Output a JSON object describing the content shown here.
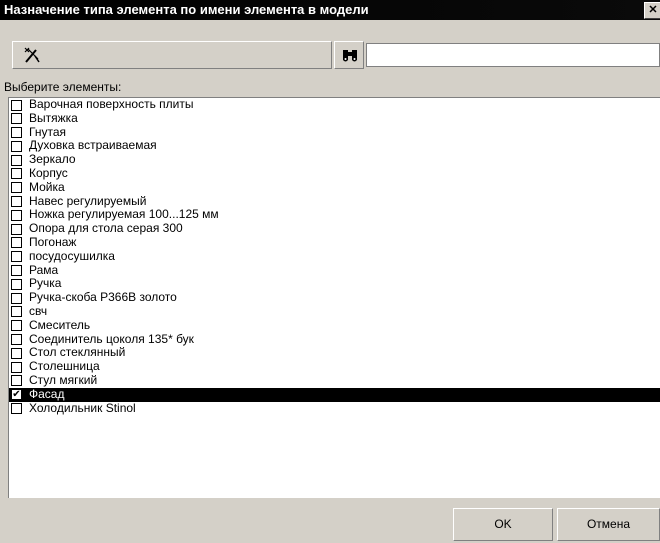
{
  "window": {
    "title": "Назначение типа элемента по имени элемента в модели",
    "close_glyph": "✕"
  },
  "toolbar": {
    "filter_icon": "magic-wand-icon",
    "search_icon": "binoculars-icon",
    "search_value": ""
  },
  "list": {
    "label": "Выберите элементы:",
    "items": [
      {
        "label": "Варочная поверхность плиты",
        "checked": false
      },
      {
        "label": "Вытяжка",
        "checked": false
      },
      {
        "label": "Гнутая",
        "checked": false
      },
      {
        "label": "Духовка встраиваемая",
        "checked": false
      },
      {
        "label": "Зеркало",
        "checked": false
      },
      {
        "label": "Корпус",
        "checked": false
      },
      {
        "label": "Мойка",
        "checked": false
      },
      {
        "label": "Навес регулируемый",
        "checked": false
      },
      {
        "label": "Ножка регулируемая 100...125 мм",
        "checked": false
      },
      {
        "label": "Опора для стола серая 300",
        "checked": false
      },
      {
        "label": "Погонаж",
        "checked": false
      },
      {
        "label": "посудосушилка",
        "checked": false
      },
      {
        "label": "Рама",
        "checked": false
      },
      {
        "label": "Ручка",
        "checked": false
      },
      {
        "label": "Ручка-скоба Р366В золото",
        "checked": false
      },
      {
        "label": "свч",
        "checked": false
      },
      {
        "label": "Смеситель",
        "checked": false
      },
      {
        "label": "Соединитель цоколя 135* бук",
        "checked": false
      },
      {
        "label": "Стол стеклянный",
        "checked": false
      },
      {
        "label": "Столешница",
        "checked": false
      },
      {
        "label": "Стул мягкий",
        "checked": false
      },
      {
        "label": "Фасад",
        "checked": true,
        "selected": true
      },
      {
        "label": "Холодильник Stinol",
        "checked": false
      }
    ]
  },
  "footer": {
    "ok_label": "OK",
    "cancel_label": "Отмена"
  }
}
